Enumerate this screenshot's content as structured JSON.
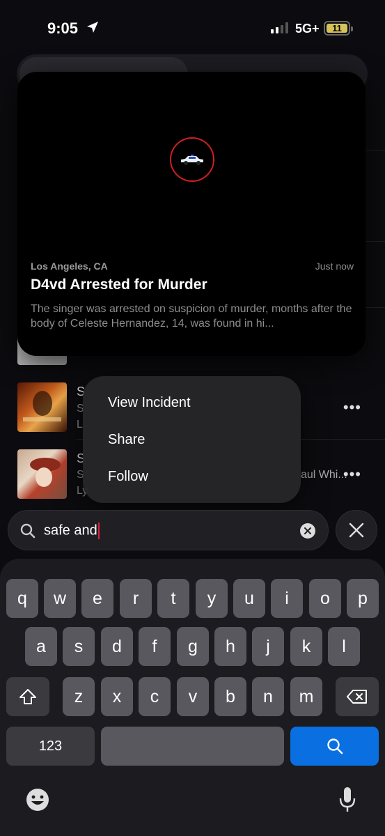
{
  "status": {
    "time": "9:05",
    "network": "5G+",
    "battery": "11"
  },
  "card": {
    "location": "Los Angeles, CA",
    "time": "Just now",
    "title": "D4vd Arrested for Murder",
    "body": "The singer was arrested on suspicion of murder, months after the body of Celeste Hernandez, 14, was found in hi..."
  },
  "background_list": [
    {
      "title": "S",
      "subtitle": "S",
      "meta": "L"
    },
    {
      "title": "S",
      "subtitle": "S",
      "trailing": "aul Whi...",
      "meta": "Ly"
    }
  ],
  "context_menu": {
    "items": [
      "View Incident",
      "Share",
      "Follow"
    ]
  },
  "search": {
    "value": "safe and"
  },
  "keyboard": {
    "row1": [
      "q",
      "w",
      "e",
      "r",
      "t",
      "y",
      "u",
      "i",
      "o",
      "p"
    ],
    "row2": [
      "a",
      "s",
      "d",
      "f",
      "g",
      "h",
      "j",
      "k",
      "l"
    ],
    "row3": [
      "z",
      "x",
      "c",
      "v",
      "b",
      "n",
      "m"
    ],
    "numbers_label": "123"
  },
  "colors": {
    "accent": "#0a6fe0",
    "pin_ring": "#d11f1f",
    "caret": "#e0203a"
  }
}
